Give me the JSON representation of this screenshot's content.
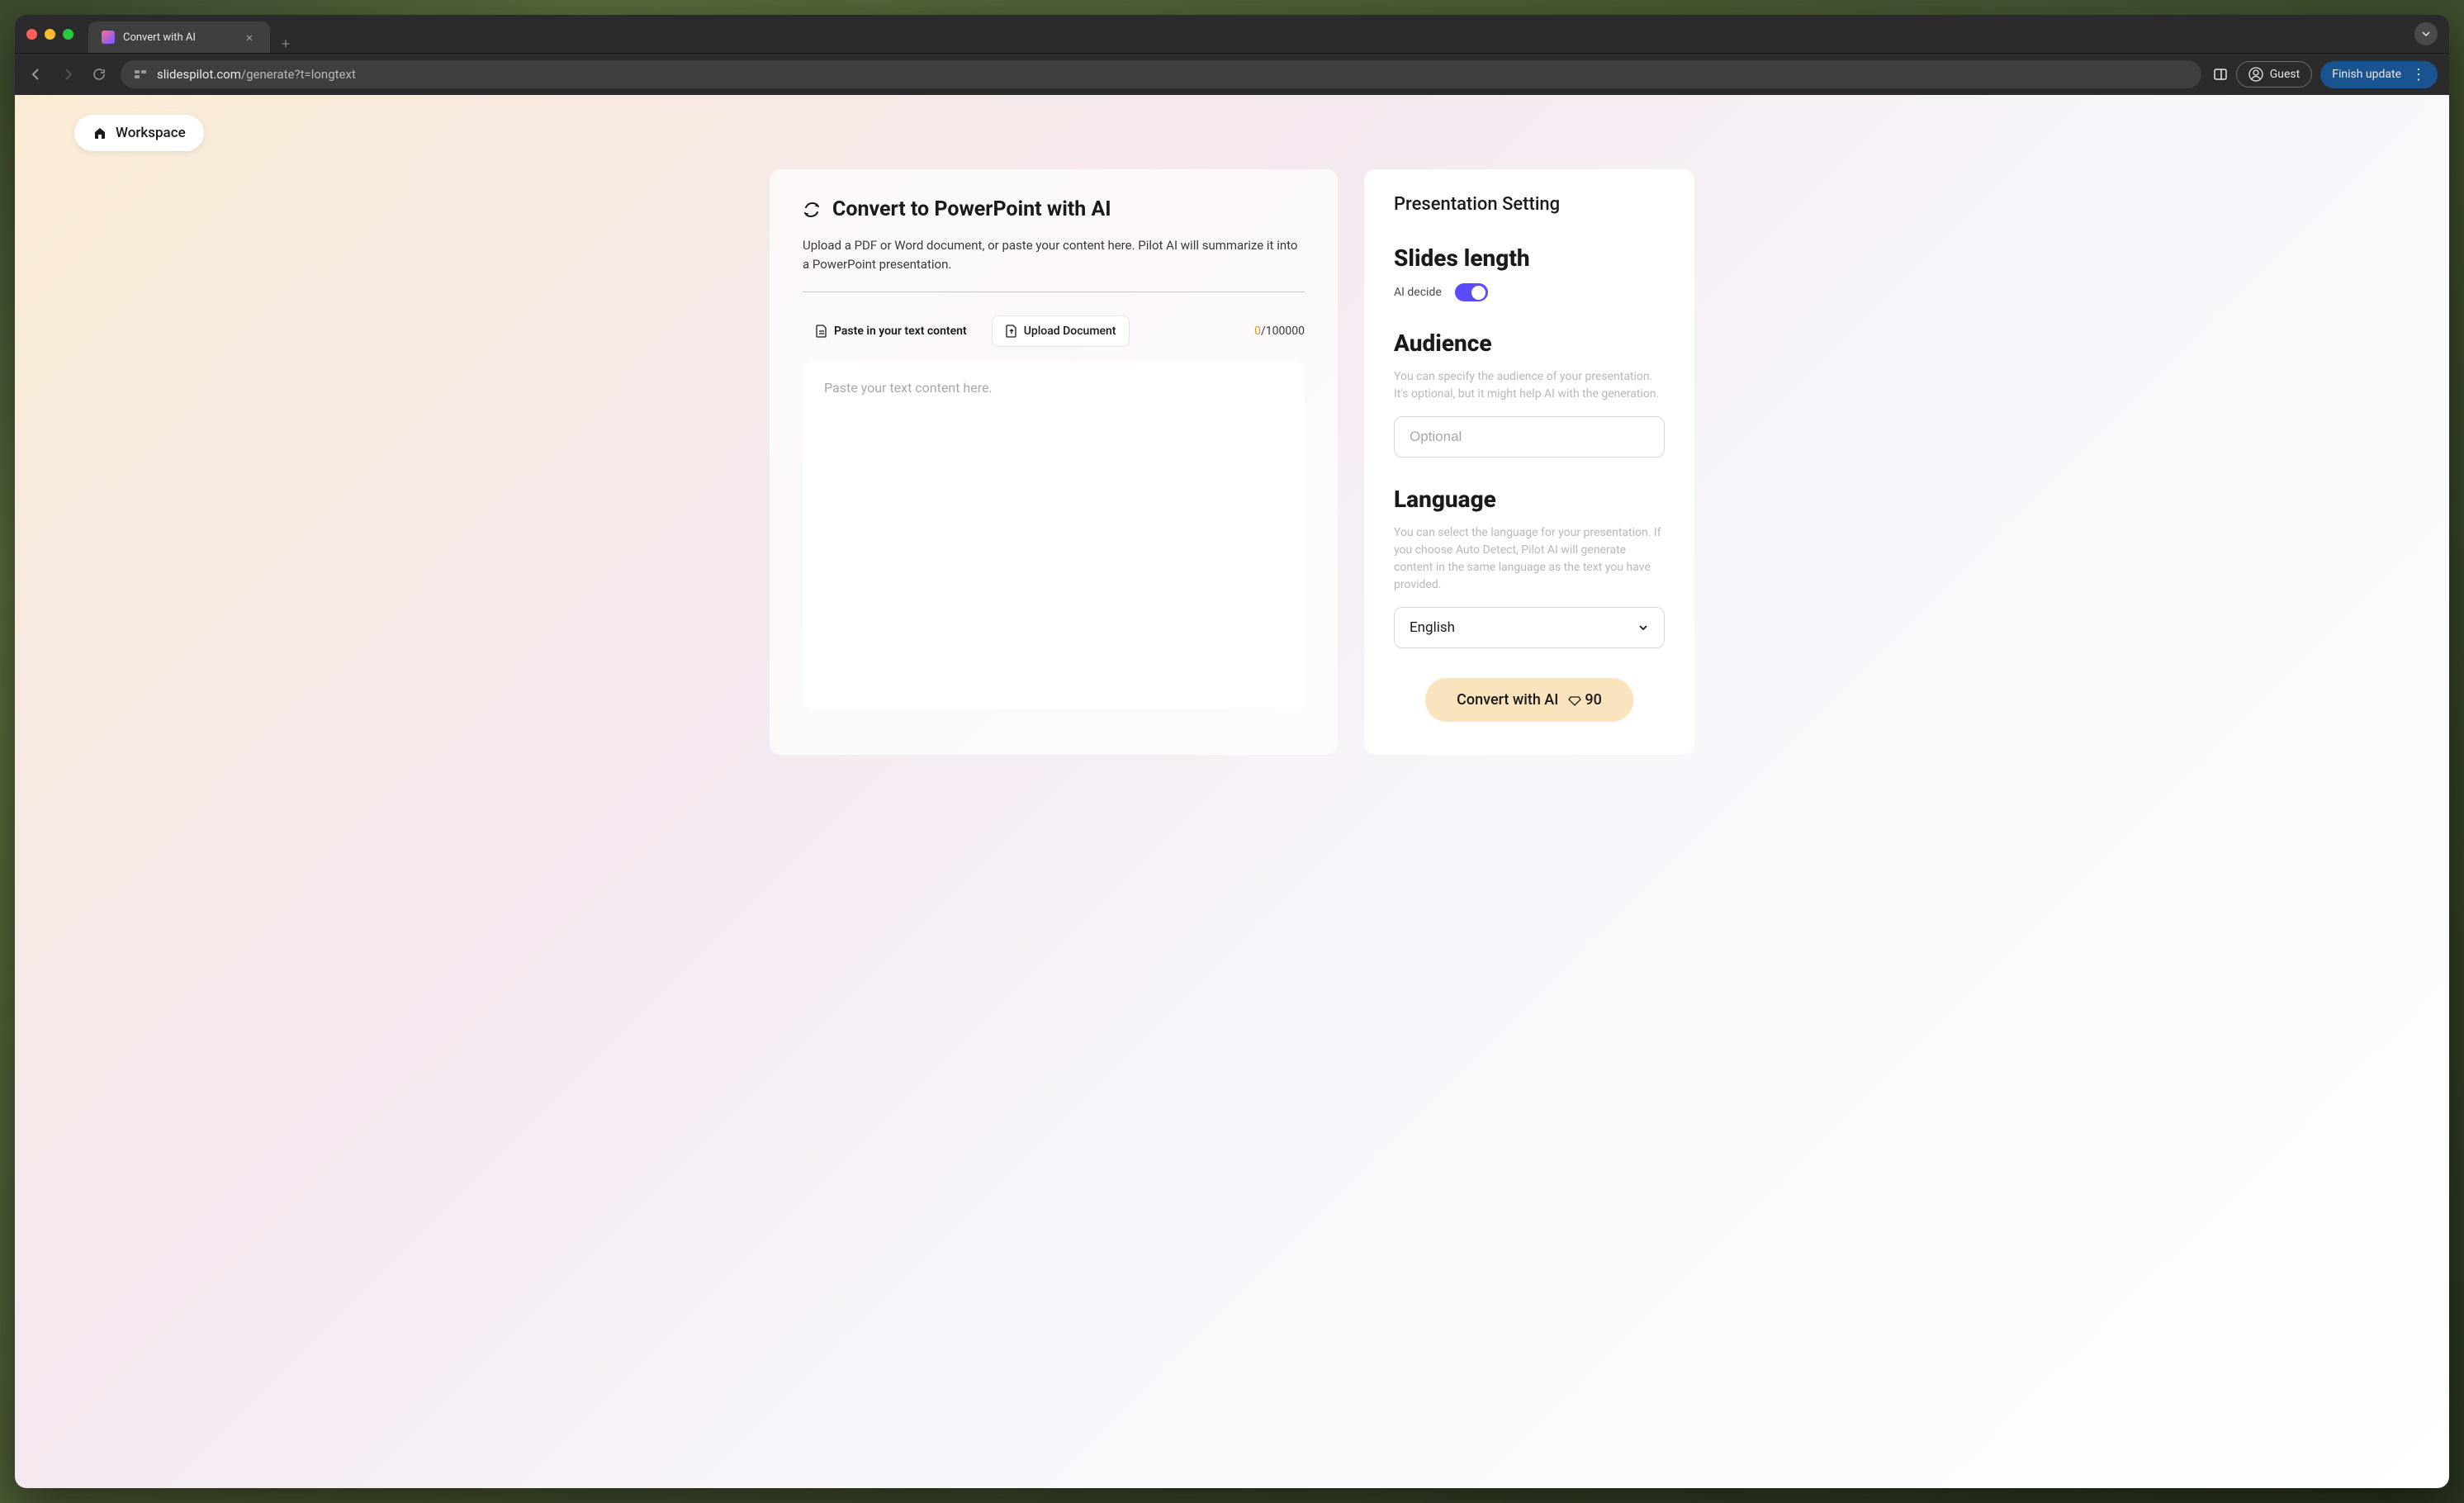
{
  "browser": {
    "tab_title": "Convert with AI",
    "url_domain": "slidespilot.com",
    "url_path": "/generate?t=longtext",
    "guest_label": "Guest",
    "finish_update": "Finish update"
  },
  "workspace_btn": "Workspace",
  "main": {
    "title": "Convert to PowerPoint with AI",
    "description": "Upload a PDF or Word document, or paste your content here. Pilot AI will summarize it into a PowerPoint presentation.",
    "tab_paste": "Paste in your text content",
    "tab_upload": "Upload Document",
    "char_current": "0",
    "char_max": "/100000",
    "textarea_placeholder": "Paste your text content here."
  },
  "settings": {
    "title": "Presentation Setting",
    "slides_length": {
      "heading": "Slides length",
      "toggle_label": "AI decide"
    },
    "audience": {
      "heading": "Audience",
      "description": "You can specify the audience of your presentation. It's optional, but it might help AI with the generation.",
      "placeholder": "Optional"
    },
    "language": {
      "heading": "Language",
      "description": "You can select the language for your presentation. If you choose Auto Detect, Pilot AI will generate content in the same language as the text you have provided.",
      "selected": "English"
    },
    "convert_btn": "Convert with AI",
    "credits": "90"
  }
}
